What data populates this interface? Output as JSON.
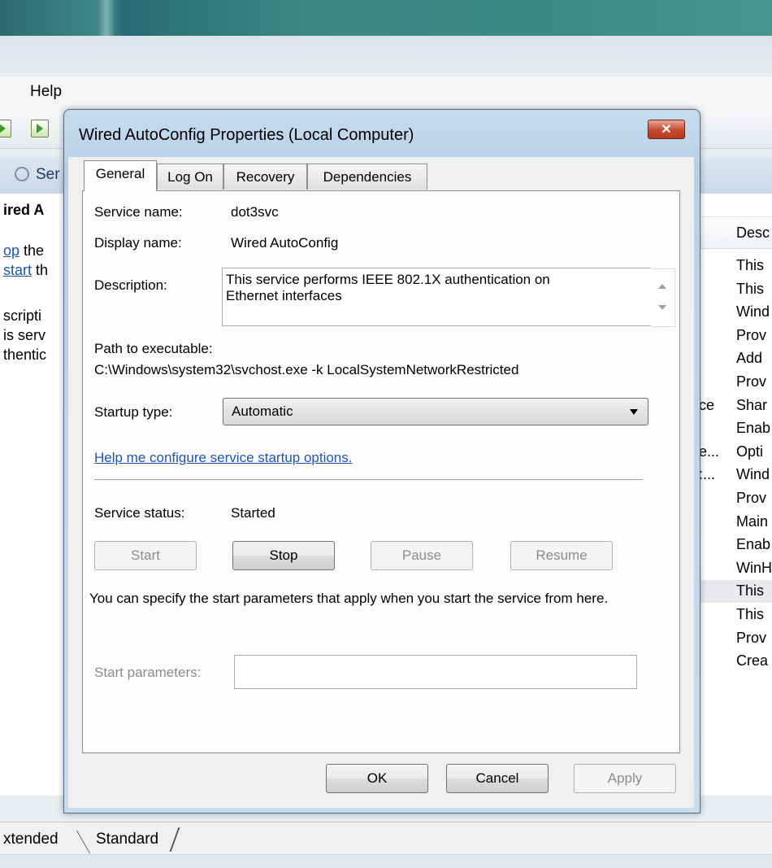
{
  "background": {
    "menu_help": "Help",
    "services_label": "Ser",
    "left_pane": {
      "heading": "ired A",
      "link_stop": "op",
      "stop_rest": " the",
      "link_start": "start",
      "start_rest": " th",
      "desc_1": "scripti",
      "desc_2": "is serv",
      "desc_3": "thentic"
    },
    "right_pane": {
      "column_header": "Desc",
      "fragments": [
        {
          "col": "",
          "desc": "This"
        },
        {
          "col": "",
          "desc": "This"
        },
        {
          "col": "",
          "desc": "Wind"
        },
        {
          "col": "",
          "desc": "Prov"
        },
        {
          "col": "",
          "desc": "Add"
        },
        {
          "col": "",
          "desc": "Prov"
        },
        {
          "col": "ce",
          "desc": "Shar"
        },
        {
          "col": "",
          "desc": "Enab"
        },
        {
          "col": "e...",
          "desc": "Opti"
        },
        {
          "col": ":...",
          "desc": "Wind"
        },
        {
          "col": "",
          "desc": "Prov"
        },
        {
          "col": "",
          "desc": "Main"
        },
        {
          "col": "",
          "desc": "Enab"
        },
        {
          "col": "",
          "desc": "WinH"
        },
        {
          "col": "",
          "desc": "This"
        },
        {
          "col": "",
          "desc": "This"
        },
        {
          "col": "",
          "desc": "Prov"
        },
        {
          "col": "",
          "desc": "Crea"
        }
      ]
    },
    "bottom_tabs": {
      "extended": "xtended",
      "standard": "Standard"
    }
  },
  "dialog": {
    "title": "Wired AutoConfig Properties (Local Computer)",
    "close_glyph": "✕",
    "tabs": [
      "General",
      "Log On",
      "Recovery",
      "Dependencies"
    ],
    "active_tab": "General",
    "general": {
      "service_name_label": "Service name:",
      "service_name_value": "dot3svc",
      "display_name_label": "Display name:",
      "display_name_value": "Wired AutoConfig",
      "description_label": "Description:",
      "description_value": "This service performs IEEE 802.1X authentication on Ethernet interfaces",
      "path_label": "Path to executable:",
      "path_value": "C:\\Windows\\system32\\svchost.exe -k LocalSystemNetworkRestricted",
      "startup_type_label": "Startup type:",
      "startup_type_value": "Automatic",
      "help_link": "Help me configure service startup options.",
      "service_status_label": "Service status:",
      "service_status_value": "Started",
      "buttons": {
        "start": "Start",
        "stop": "Stop",
        "pause": "Pause",
        "resume": "Resume"
      },
      "start_params_note": "You can specify the start parameters that apply when you start the service from here.",
      "start_params_label": "Start parameters:",
      "start_params_value": ""
    },
    "footer": {
      "ok": "OK",
      "cancel": "Cancel",
      "apply": "Apply"
    }
  }
}
